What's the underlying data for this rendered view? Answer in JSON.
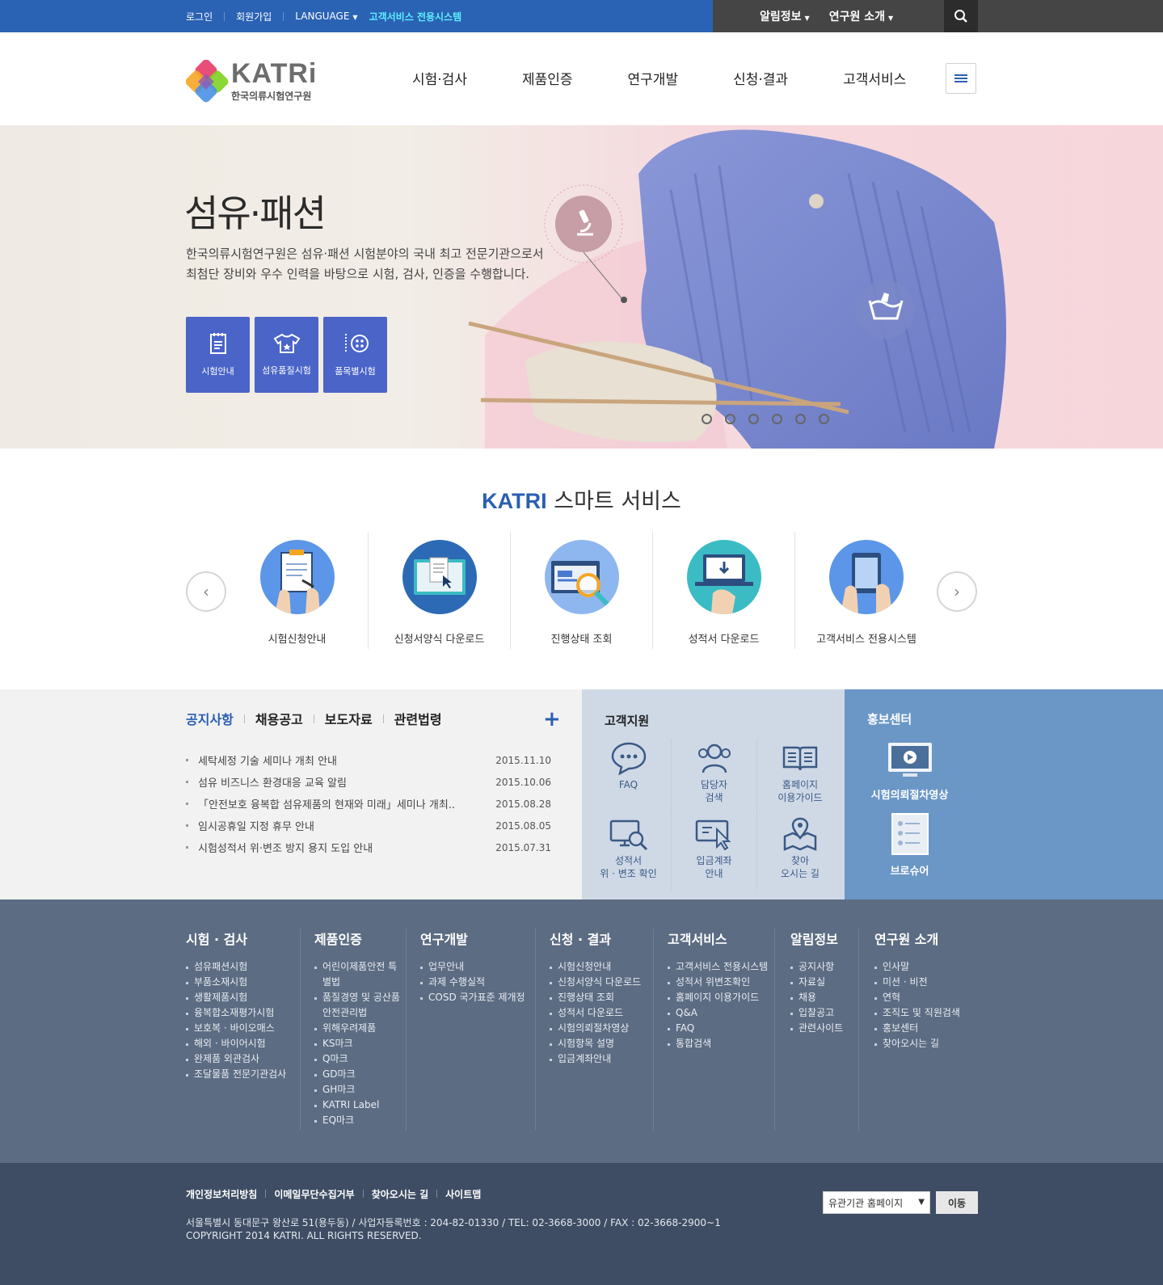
{
  "topbar": {
    "login": "로그인",
    "join": "회원가입",
    "language": "LANGUAGE",
    "customer_system": "고객서비스 전용시스템",
    "notice_menu": "알림정보",
    "about_menu": "연구원 소개",
    "colors": {
      "blue": "#2a62b4",
      "dark": "#454545",
      "highlight": "#5df0ff"
    }
  },
  "header": {
    "logo_text": "KATRi",
    "logo_sub": "한국의류시험연구원",
    "nav": [
      "시험·검사",
      "제품인증",
      "연구개발",
      "신청·결과",
      "고객서비스"
    ]
  },
  "hero": {
    "title": "섬유·패션",
    "desc_line1": "한국의류시험연구원은 섬유·패션 시험분야의 국내 최고 전문기관으로서",
    "desc_line2": "최첨단 장비와 우수 인력을 바탕으로 시험, 검사, 인증을 수행합니다.",
    "buttons": [
      "시험안내",
      "섬유품질시험",
      "품목별시험"
    ],
    "slide_count": 6
  },
  "smart": {
    "brand": "KATRI",
    "title": "스마트 서비스",
    "items": [
      "시험신청안내",
      "신청서양식 다운로드",
      "진행상태 조회",
      "성적서 다운로드",
      "고객서비스 전용시스템"
    ]
  },
  "notice": {
    "tabs": [
      "공지사항",
      "채용공고",
      "보도자료",
      "관련법령"
    ],
    "more": "+",
    "items": [
      {
        "title": "세탁세정 기술 세미나 개최 안내",
        "date": "2015.11.10"
      },
      {
        "title": "섬유 비즈니스 환경대응 교육 알림",
        "date": "2015.10.06"
      },
      {
        "title": "「안전보호 융복합 섬유제품의 현재와 미래」세미나 개최..",
        "date": "2015.08.28"
      },
      {
        "title": "임시공휴일 지정 휴무 안내",
        "date": "2015.08.05"
      },
      {
        "title": "시험성적서 위·변조 방지 용지 도입 안내",
        "date": "2015.07.31"
      }
    ]
  },
  "support": {
    "title": "고객지원",
    "items": [
      {
        "l1": "FAQ",
        "l2": ""
      },
      {
        "l1": "담당자",
        "l2": "검색"
      },
      {
        "l1": "홈페이지",
        "l2": "이용가이드"
      },
      {
        "l1": "성적서",
        "l2": "위 · 변조 확인"
      },
      {
        "l1": "입금계좌",
        "l2": "안내"
      },
      {
        "l1": "찾아",
        "l2": "오시는 길"
      }
    ]
  },
  "promo": {
    "title": "홍보센터",
    "video": "시험의뢰절차영상",
    "brochure": "브로슈어"
  },
  "sitemap": [
    {
      "title": "시험 · 검사",
      "items": [
        "섬유패션시험",
        "부품소재시험",
        "생활제품시험",
        "융복합소재평가시험",
        "보호복 · 바이오매스",
        "해외 · 바이어시험",
        "완제품 외관검사",
        "조달물품 전문기관검사"
      ]
    },
    {
      "title": "제품인증",
      "items": [
        "어린이제품안전 특별법",
        "품질경영 및 공산품 안전관리법",
        "위해우려제품",
        "KS마크",
        "Q마크",
        "GD마크",
        "GH마크",
        "KATRI Label",
        "EQ마크"
      ]
    },
    {
      "title": "연구개발",
      "items": [
        "업무안내",
        "과제 수행실적",
        "COSD 국가표준 제개정"
      ]
    },
    {
      "title": "신청 · 결과",
      "items": [
        "시험신청안내",
        "신청서양식 다운로드",
        "진행상태 조회",
        "성적서 다운로드",
        "시험의뢰절차영상",
        "시험항목 설명",
        "입금계좌안내"
      ]
    },
    {
      "title": "고객서비스",
      "items": [
        "고객서비스 전용시스템",
        "성적서 위변조확인",
        "홈페이지 이용가이드",
        "Q&A",
        "FAQ",
        "통합검색"
      ]
    },
    {
      "title": "알림정보",
      "items": [
        "공지사항",
        "자료실",
        "채용",
        "입찰공고",
        "관련사이트"
      ]
    },
    {
      "title": "연구원 소개",
      "items": [
        "인사말",
        "미션 · 비전",
        "연혁",
        "조직도 및 직원검색",
        "홍보센터",
        "찾아오시는 길"
      ]
    }
  ],
  "footer": {
    "links": [
      "개인정보처리방침",
      "이메일무단수집거부",
      "찾아오시는 길",
      "사이트맵"
    ],
    "address": "서울특별시 동대문구 왕산로 51(용두동) / 사업자등록번호 : 204-82-01330 / TEL: 02-3668-3000 / FAX : 02-3668-2900~1",
    "copyright": "COPYRIGHT 2014 KATRI. ALL RIGHTS RESERVED.",
    "select_value": "유관기관 홈페이지",
    "go": "이동"
  }
}
